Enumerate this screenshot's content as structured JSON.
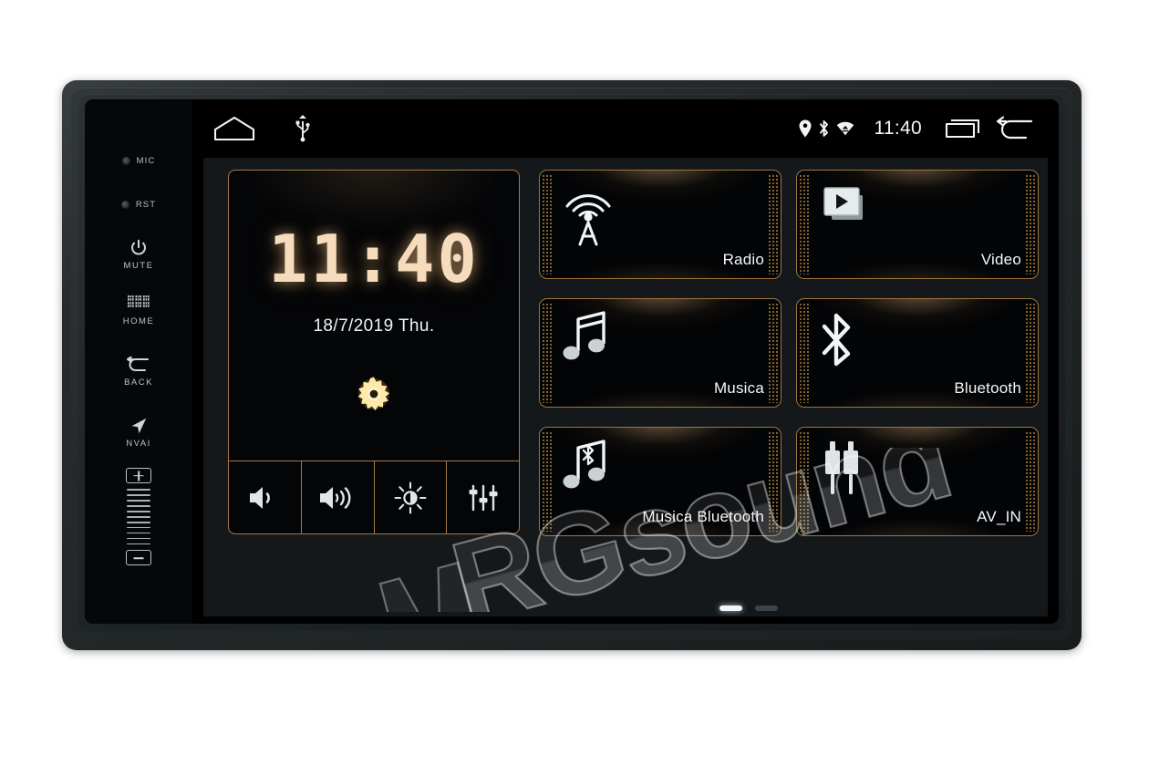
{
  "device": {
    "name": "double-din-car-head-unit",
    "bezel_color": "#222627"
  },
  "hardkeys": [
    {
      "id": "mic",
      "label": "MIC",
      "type": "led"
    },
    {
      "id": "rst",
      "label": "RST",
      "type": "led"
    },
    {
      "id": "mute",
      "label": "MUTE",
      "icon": "power-icon"
    },
    {
      "id": "home",
      "label": "HOME",
      "icon": "grid-icon"
    },
    {
      "id": "back",
      "label": "BACK",
      "icon": "back-arrow-icon"
    },
    {
      "id": "nvai",
      "label": "NVAI",
      "icon": "navigation-arrow-icon"
    }
  ],
  "volume_rocker": {
    "plus_label": "+",
    "minus_label": "-",
    "tick_count": 11
  },
  "statusbar": {
    "left_icons": [
      {
        "name": "home-icon",
        "label": "Home"
      },
      {
        "name": "usb-icon",
        "label": "USB"
      }
    ],
    "status_icons": [
      {
        "name": "location-pin-icon",
        "label": "Location"
      },
      {
        "name": "bluetooth-icon",
        "label": "Bluetooth"
      },
      {
        "name": "wifi-icon",
        "label": "Wi-Fi"
      }
    ],
    "clock": "11:40",
    "right_icons": [
      {
        "name": "recent-apps-icon",
        "label": "Recent apps"
      },
      {
        "name": "back-arrow-icon",
        "label": "Back"
      }
    ]
  },
  "clock_widget": {
    "time": "11:40",
    "date": "18/7/2019   Thu.",
    "settings_icon": "gear-icon",
    "accent_color": "#a5784a",
    "digit_color": "#f6dcbc",
    "controls": [
      {
        "name": "volume-down-icon",
        "label": "Volume down"
      },
      {
        "name": "volume-up-icon",
        "label": "Volume up"
      },
      {
        "name": "brightness-icon",
        "label": "Brightness"
      },
      {
        "name": "equalizer-icon",
        "label": "Equalizer"
      }
    ]
  },
  "tiles": [
    {
      "label": "Radio",
      "icon": "radio-tower-icon"
    },
    {
      "label": "Video",
      "icon": "video-play-icon"
    },
    {
      "label": "Musica",
      "icon": "music-note-icon"
    },
    {
      "label": "Bluetooth",
      "icon": "bluetooth-icon"
    },
    {
      "label": "Musica Bluetooth",
      "icon": "music-bluetooth-icon"
    },
    {
      "label": "AV_IN",
      "icon": "rca-plug-icon"
    }
  ],
  "pager": {
    "total": 2,
    "active_index": 0
  },
  "watermark": {
    "text": "RGsound"
  }
}
